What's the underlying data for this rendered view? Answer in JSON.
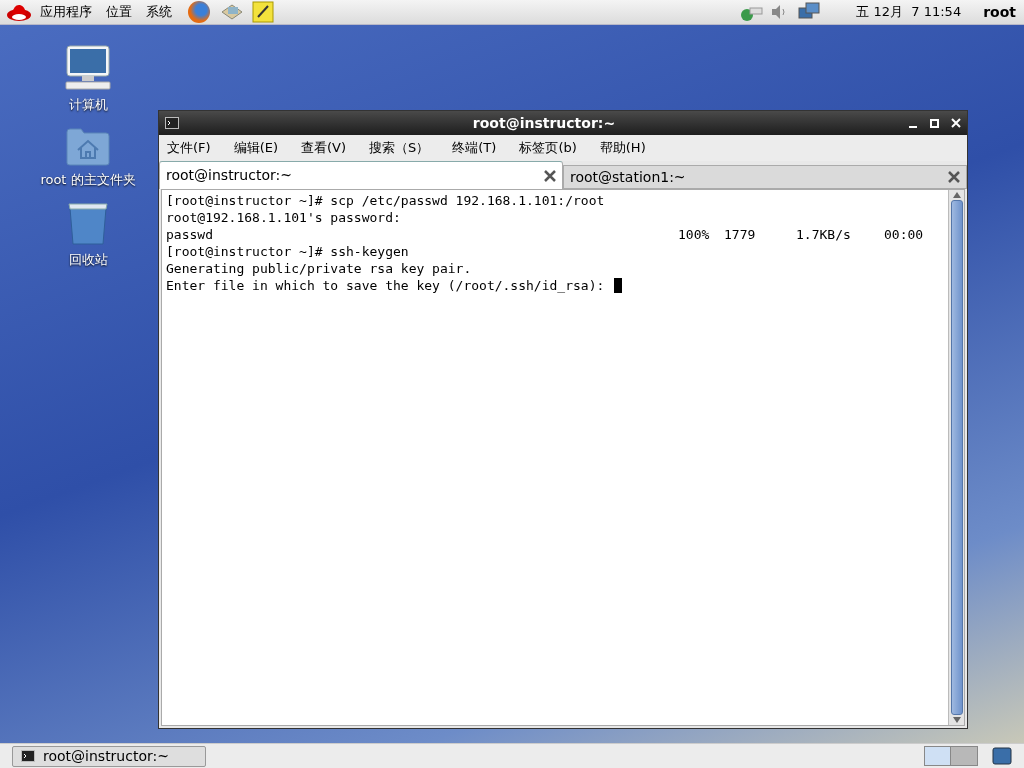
{
  "top_panel": {
    "menus": [
      "应用程序",
      "位置",
      "系统"
    ],
    "clock": "五 12月  7 11:54",
    "user": "root"
  },
  "desktop_icons": [
    {
      "kind": "computer",
      "label": "计算机"
    },
    {
      "kind": "home",
      "label": "root 的主文件夹"
    },
    {
      "kind": "trash",
      "label": "回收站"
    }
  ],
  "window": {
    "title": "root@instructor:~",
    "menu": [
      "文件(F)",
      "编辑(E)",
      "查看(V)",
      "搜索（S）",
      "终端(T)",
      "标签页(b)",
      "帮助(H)"
    ],
    "tabs": [
      {
        "label": "root@instructor:~",
        "selected": true
      },
      {
        "label": "root@station1:~",
        "selected": false
      }
    ],
    "terminal": [
      {
        "kind": "text",
        "text": "[root@instructor ~]# scp /etc/passwd 192.168.1.101:/root"
      },
      {
        "kind": "text",
        "text": "root@192.168.1.101's password:"
      },
      {
        "kind": "transfer",
        "file": "passwd",
        "percent": "100%",
        "size": "1779",
        "rate": "1.7KB/s",
        "time": "00:00"
      },
      {
        "kind": "text",
        "text": "[root@instructor ~]# ssh-keygen"
      },
      {
        "kind": "text",
        "text": "Generating public/private rsa key pair."
      },
      {
        "kind": "prompt",
        "text": "Enter file in which to save the key (/root/.ssh/id_rsa):"
      }
    ]
  },
  "taskbar": {
    "tasks": [
      {
        "label": "root@instructor:~",
        "selected": false
      }
    ]
  }
}
